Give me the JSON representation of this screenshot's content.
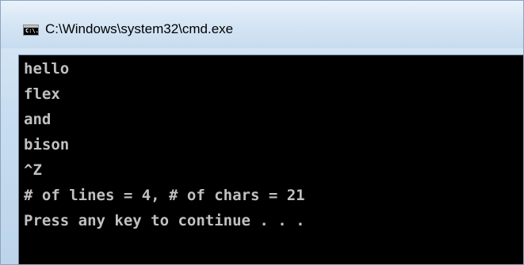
{
  "window": {
    "title": "C:\\Windows\\system32\\cmd.exe",
    "icon": "console-window-icon",
    "icon_glyph": "C:\\."
  },
  "console": {
    "lines": [
      "hello",
      "flex",
      "and",
      "bison",
      "^Z",
      "# of lines = 4, # of chars = 21",
      "Press any key to continue . . ."
    ],
    "text_color": "#c0c0c0",
    "background_color": "#000000"
  }
}
